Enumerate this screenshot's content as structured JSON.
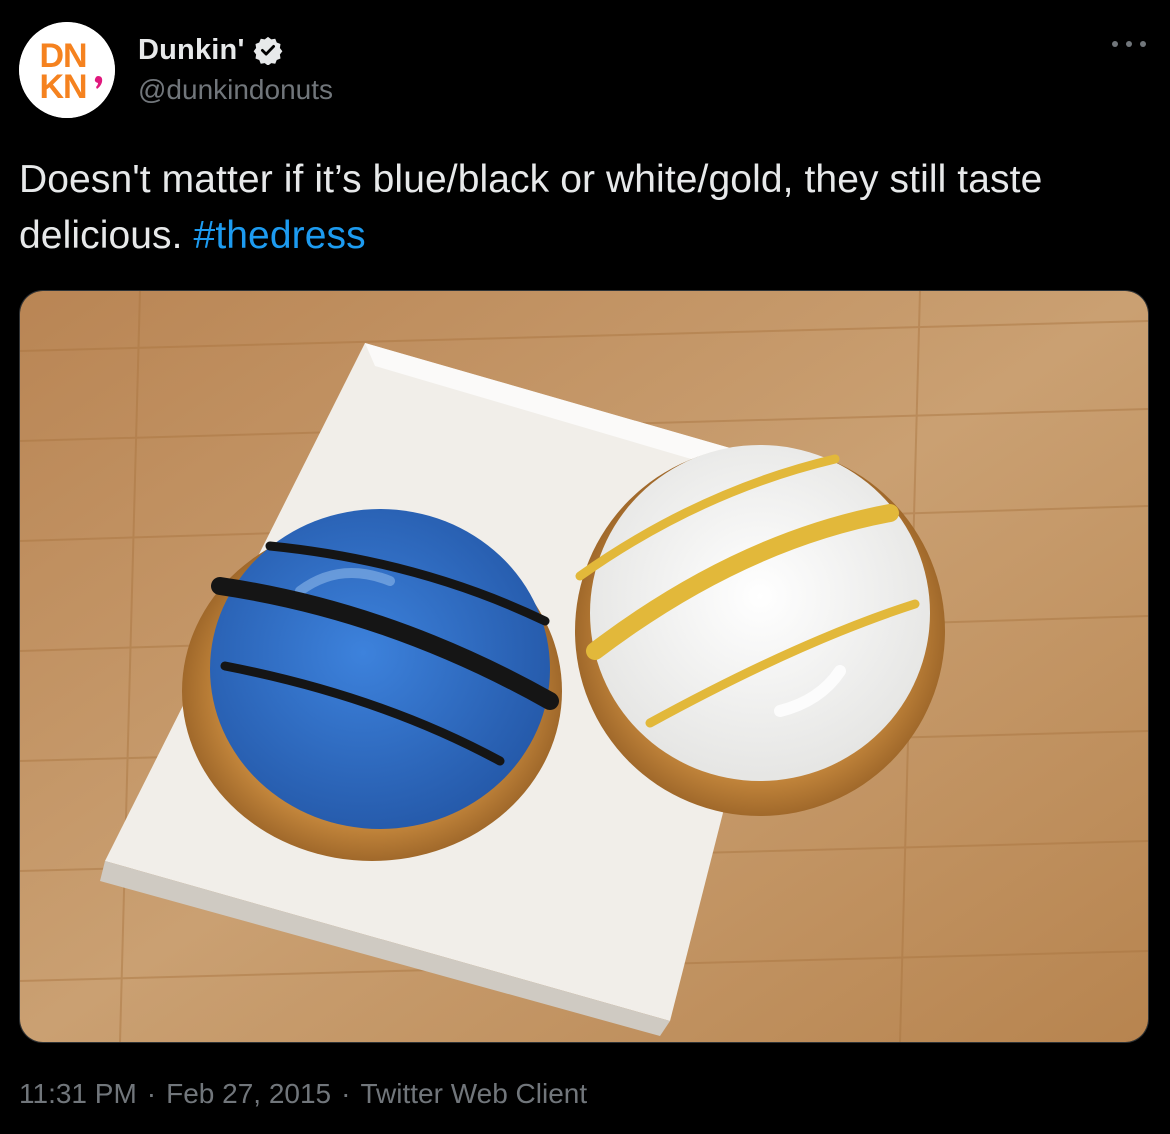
{
  "author": {
    "display_name": "Dunkin'",
    "handle": "@dunkindonuts",
    "verified": true,
    "avatar": {
      "icon": "dunkin-logo",
      "logo_lines": [
        "DN",
        "KN"
      ],
      "colors": {
        "orange": "#f5821f",
        "pink": "#e0187d"
      }
    }
  },
  "tweet": {
    "text": "Doesn't matter if it’s blue/black or white/gold, they still taste delicious.",
    "hashtag": "#thedress"
  },
  "media": {
    "icon": "photo-blue-and-white-donuts",
    "colors": {
      "wood": "#c79567",
      "plate": "#f1eee9",
      "blue_icing": "#2f6fc8",
      "black_drizzle": "#151515",
      "white_icing": "#f6f6f4",
      "gold_drizzle": "#e2b83a"
    }
  },
  "meta": {
    "time": "11:31 PM",
    "date": "Feb 27, 2015",
    "client": "Twitter Web Client",
    "separator": "·"
  },
  "ui": {
    "more_icon": "more-horizontal-icon",
    "verified_icon": "verified-badge-icon",
    "theme": {
      "background": "#000000",
      "text": "#e7e9ea",
      "muted": "#71767b",
      "link": "#1d9bf0"
    }
  }
}
